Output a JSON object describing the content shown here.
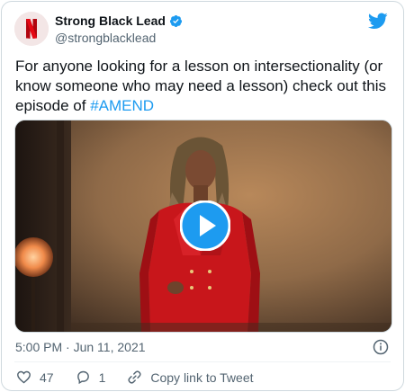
{
  "author": {
    "display_name": "Strong Black Lead",
    "handle": "@strongblacklead",
    "verified": true,
    "avatar_icon": "netflix-n-logo",
    "avatar_color": "#e50914"
  },
  "tweet": {
    "text_main": "For anyone looking for a lesson on intersectionality (or know someone who may need a lesson) check out this episode of ",
    "hashtag": "#AMEND",
    "media_type": "video",
    "play_icon": "play-icon"
  },
  "meta": {
    "time": "5:00 PM",
    "separator": " · ",
    "date": "Jun 11, 2021"
  },
  "actions": {
    "like_count": "47",
    "reply_count": "1",
    "copy_link_label": "Copy link to Tweet"
  },
  "colors": {
    "accent": "#1d9bf0",
    "like": "#536471",
    "text_primary": "#0f1419",
    "text_secondary": "#536471"
  }
}
